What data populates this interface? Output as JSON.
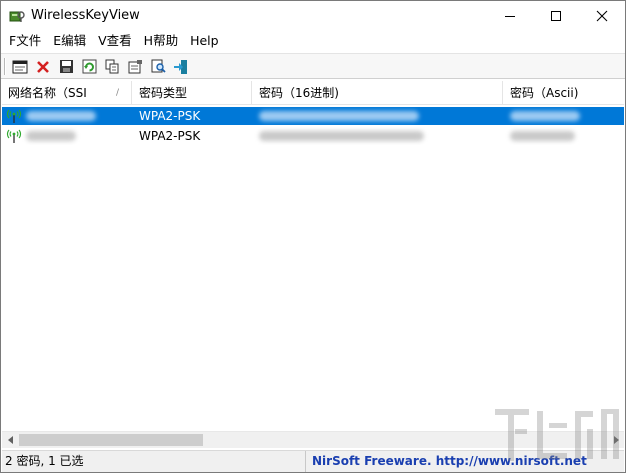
{
  "window": {
    "title": "WirelessKeyView"
  },
  "menu": {
    "items": [
      "F文件",
      "E编辑",
      "V查看",
      "H帮助",
      "Help"
    ]
  },
  "toolbar": {
    "buttons": [
      {
        "icon": "properties-window-icon"
      },
      {
        "icon": "delete-x-icon",
        "color": "#d42020"
      },
      {
        "icon": "save-disk-icon"
      },
      {
        "icon": "refresh-icon",
        "color": "#2f9a2f"
      },
      {
        "icon": "copy-icon"
      },
      {
        "icon": "properties-icon"
      },
      {
        "icon": "find-icon"
      },
      {
        "icon": "exit-door-icon",
        "color": "#1a7fa0"
      }
    ]
  },
  "table": {
    "columns": [
      "网络名称（SSI",
      "密码类型",
      "密码（16进制)",
      "密码（Ascii)"
    ],
    "sort_indicator": "/",
    "rows": [
      {
        "ssid": "",
        "type": "WPA2-PSK",
        "hex": "",
        "ascii": "",
        "selected": true
      },
      {
        "ssid": "",
        "type": "WPA2-PSK",
        "hex": "",
        "ascii": "",
        "selected": false
      }
    ]
  },
  "status": {
    "left": "2 密码, 1 已选",
    "right": "NirSoft Freeware.  http://www.nirsoft.net"
  },
  "colors": {
    "selection": "#0078d7",
    "link": "#1a3fb0"
  }
}
